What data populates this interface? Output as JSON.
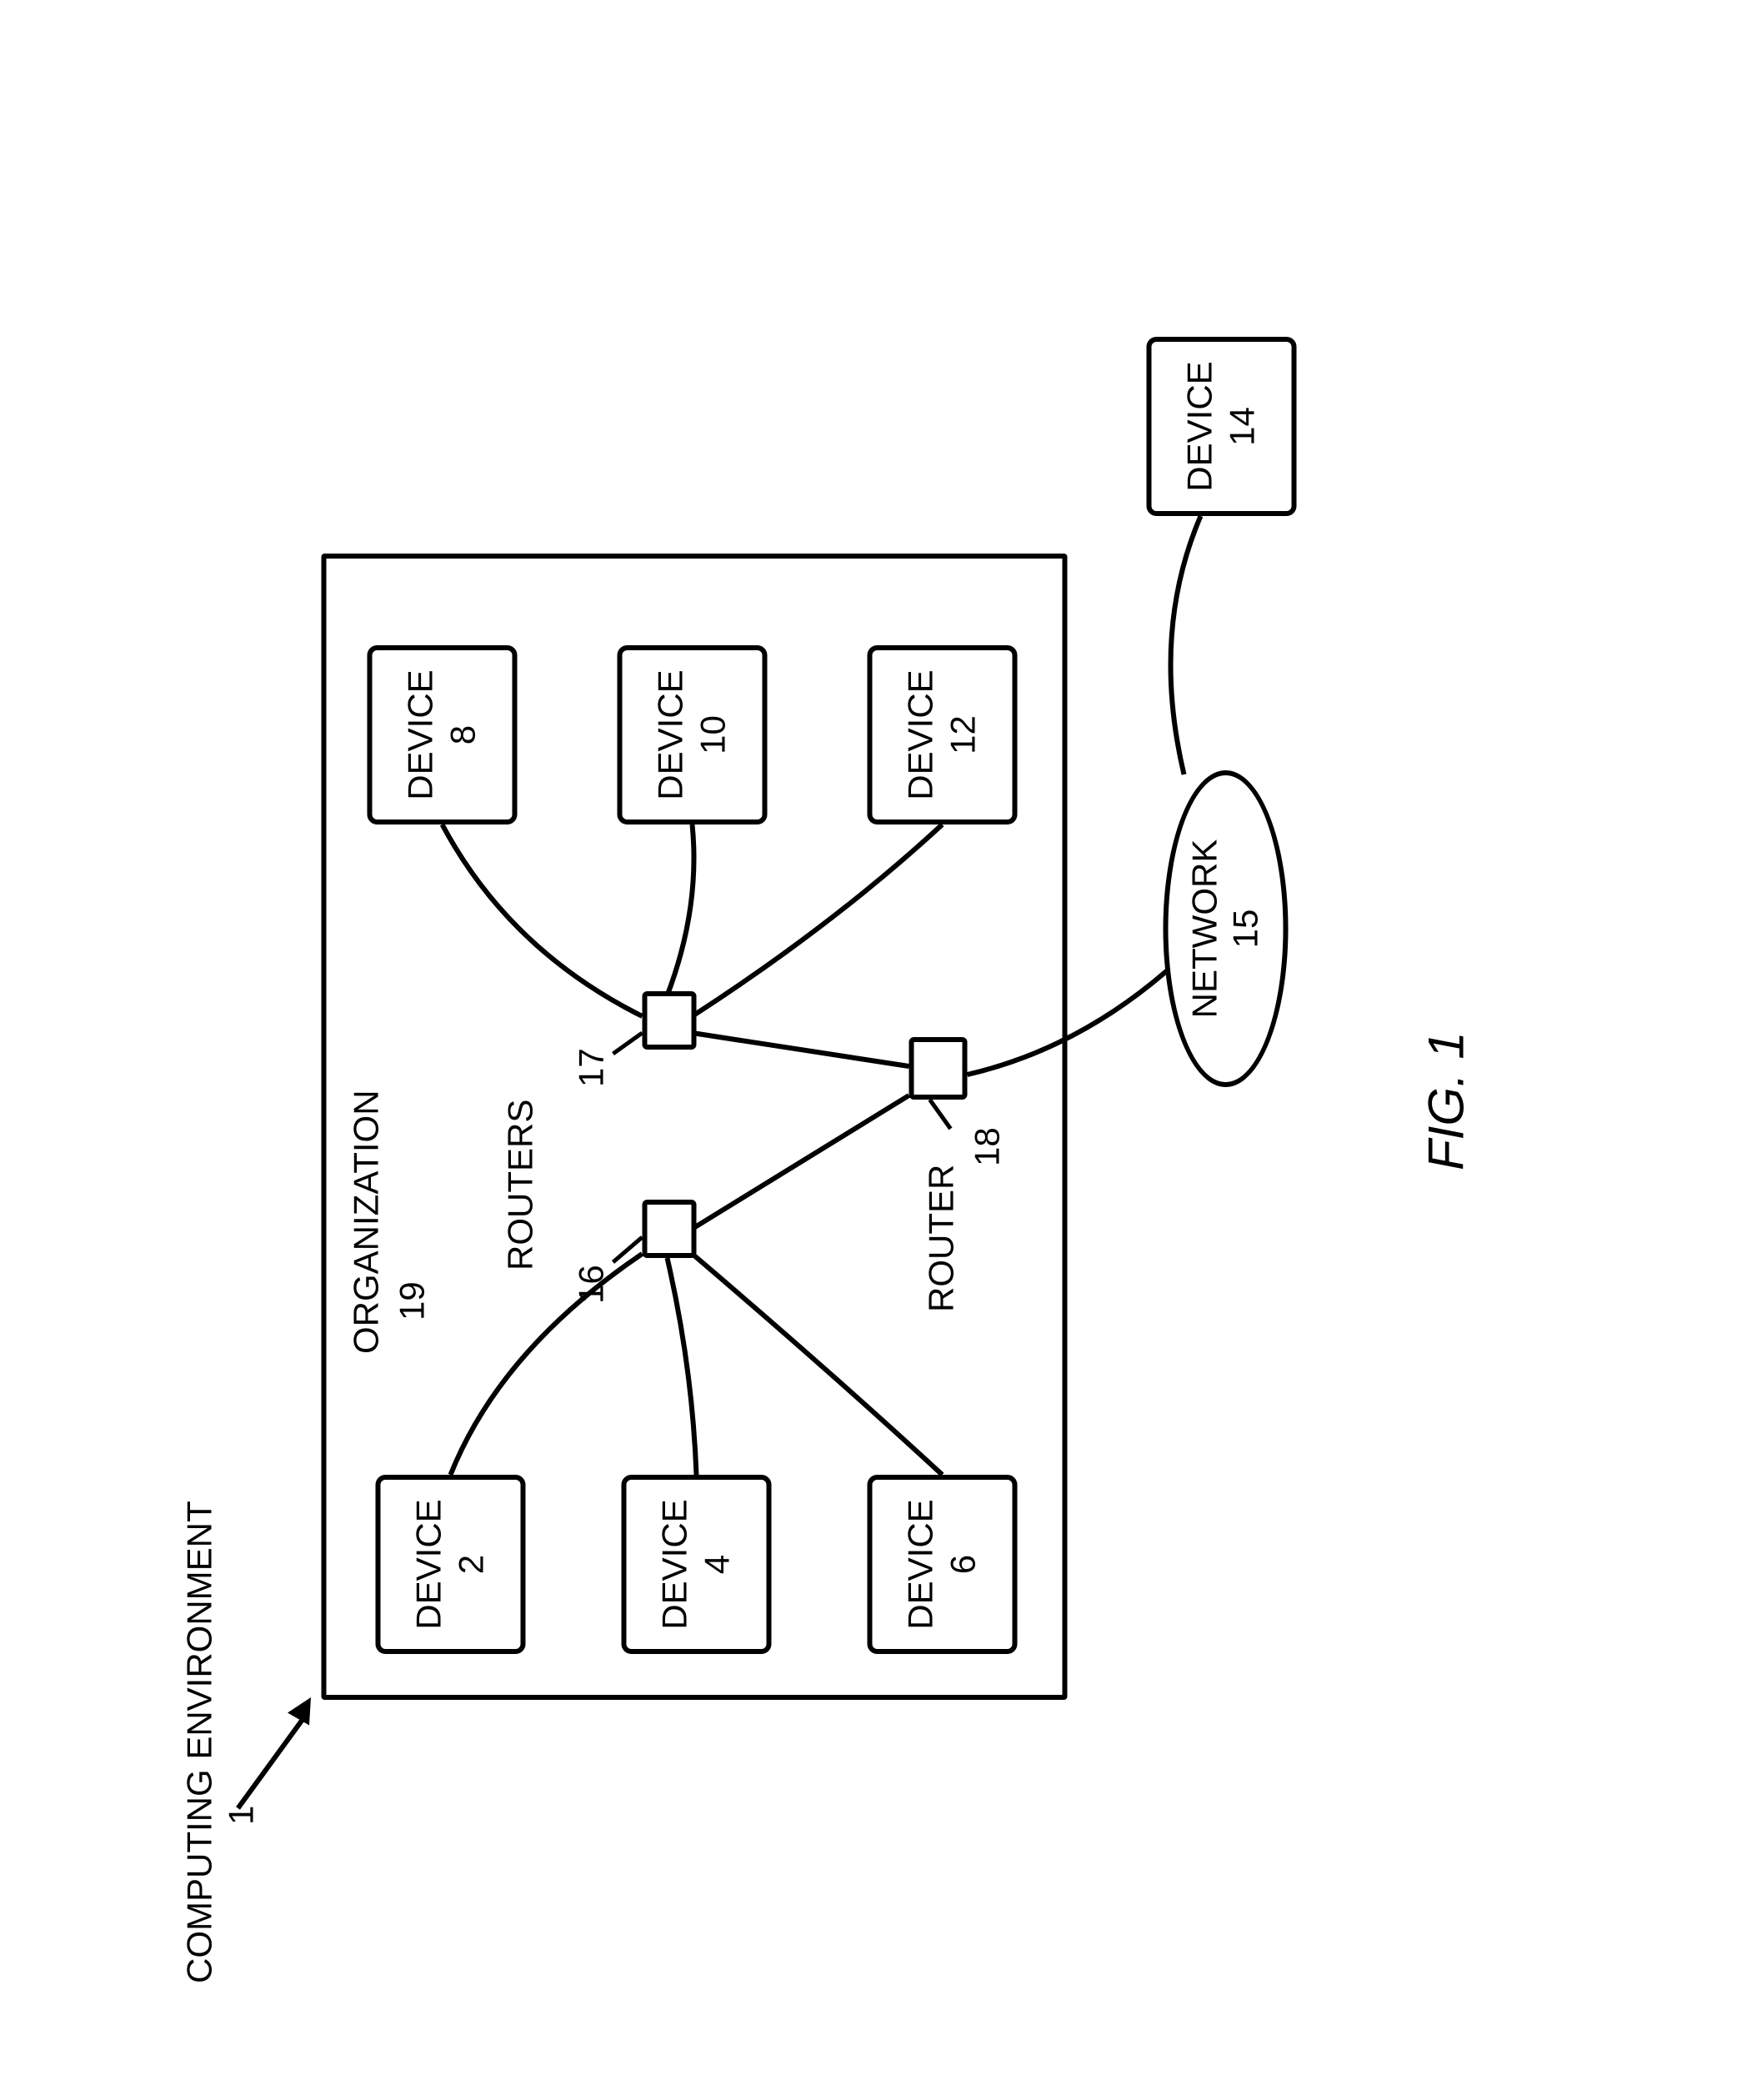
{
  "title": "COMPUTING ENVIRONMENT",
  "titleNum": "1",
  "organization": {
    "label": "ORGANIZATION",
    "num": "19"
  },
  "routers": {
    "label": "ROUTERS",
    "left": {
      "num": "16"
    },
    "right": {
      "num": "17"
    },
    "bottom": {
      "label": "ROUTER",
      "num": "18"
    }
  },
  "devices": {
    "d2": {
      "label": "DEVICE",
      "num": "2"
    },
    "d4": {
      "label": "DEVICE",
      "num": "4"
    },
    "d6": {
      "label": "DEVICE",
      "num": "6"
    },
    "d8": {
      "label": "DEVICE",
      "num": "8"
    },
    "d10": {
      "label": "DEVICE",
      "num": "10"
    },
    "d12": {
      "label": "DEVICE",
      "num": "12"
    },
    "d14": {
      "label": "DEVICE",
      "num": "14"
    }
  },
  "network": {
    "label": "NETWORK",
    "num": "15"
  },
  "figure": "FIG. 1"
}
